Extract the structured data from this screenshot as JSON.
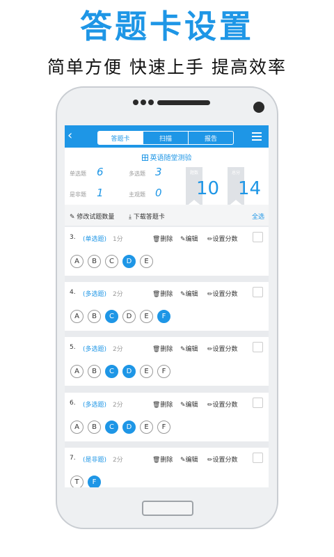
{
  "hero": {
    "title": "答题卡设置",
    "subtitle": "简单方便 快速上手 提高效率"
  },
  "app": {
    "back_icon": "‹",
    "tabs": [
      {
        "label": "答题卡",
        "active": true
      },
      {
        "label": "扫描",
        "active": false
      },
      {
        "label": "报告",
        "active": false
      }
    ],
    "quiz_title": "英语随堂测验",
    "stats": {
      "single_label": "单选题",
      "single_value": "6",
      "multi_label": "多选题",
      "multi_value": "3",
      "tf_label": "是非题",
      "tf_value": "1",
      "subjective_label": "主观题",
      "subjective_value": "0"
    },
    "ribbon1_label": "题数",
    "ribbon2_label": "总分",
    "big_num_1": "10",
    "big_num_2": "14",
    "actions": {
      "modify": "修改试题数量",
      "download": "下载答题卡",
      "select_all": "全选"
    },
    "op_labels": {
      "delete": "删除",
      "edit": "编辑",
      "set_score": "设置分数"
    },
    "questions": [
      {
        "num": "3.",
        "type": "(单选题)",
        "score": "1分",
        "options": [
          "A",
          "B",
          "C",
          "D",
          "E"
        ],
        "selected": [
          "D"
        ]
      },
      {
        "num": "4.",
        "type": "(多选题)",
        "score": "2分",
        "options": [
          "A",
          "B",
          "C",
          "D",
          "E",
          "F"
        ],
        "selected": [
          "C",
          "F"
        ]
      },
      {
        "num": "5.",
        "type": "(多选题)",
        "score": "2分",
        "options": [
          "A",
          "B",
          "C",
          "D",
          "E",
          "F"
        ],
        "selected": [
          "C",
          "D"
        ]
      },
      {
        "num": "6.",
        "type": "(多选题)",
        "score": "2分",
        "options": [
          "A",
          "B",
          "C",
          "D",
          "E",
          "F"
        ],
        "selected": [
          "C",
          "D"
        ]
      },
      {
        "num": "7.",
        "type": "(是非题)",
        "score": "2分",
        "options": [
          "T",
          "F"
        ],
        "selected": [
          "F"
        ]
      }
    ],
    "colors": {
      "accent": "#1e96e6"
    }
  }
}
